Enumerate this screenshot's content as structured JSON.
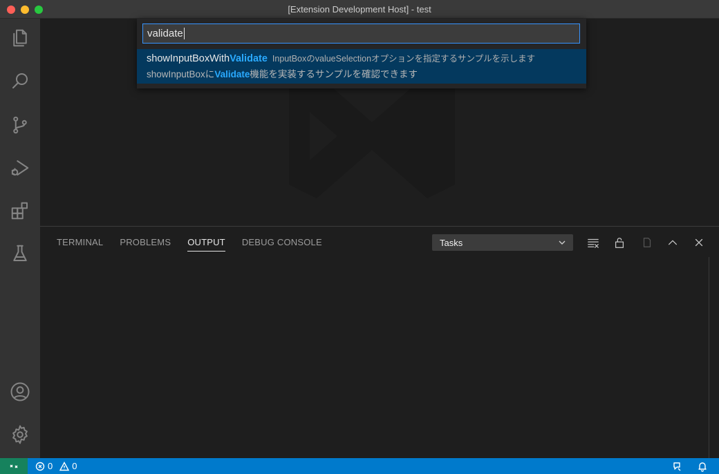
{
  "window": {
    "title": "[Extension Development Host] - test"
  },
  "activity_bar": {
    "items": [
      "files-icon",
      "search-icon",
      "source-control-icon",
      "run-debug-icon",
      "extensions-icon",
      "testing-icon"
    ],
    "bottom": [
      "account-icon",
      "settings-gear-icon"
    ]
  },
  "quick_input": {
    "value": "validate",
    "item": {
      "label_prefix": "showInputBoxWith",
      "label_match": "Validate",
      "description": "InputBoxのvalueSelectionオプションを指定するサンプルを示します",
      "detail_prefix": "showInputBoxに",
      "detail_match": "Validate",
      "detail_suffix": "機能を実装するサンプルを確認できます"
    }
  },
  "panel": {
    "tabs": [
      "TERMINAL",
      "PROBLEMS",
      "OUTPUT",
      "DEBUG CONSOLE"
    ],
    "active_tab": "OUTPUT",
    "output_channel": "Tasks"
  },
  "status_bar": {
    "errors": "0",
    "warnings": "0"
  },
  "colors": {
    "accent": "#007acc",
    "remote": "#16825d",
    "highlight": "#2aaaff",
    "selection": "#04395e"
  }
}
